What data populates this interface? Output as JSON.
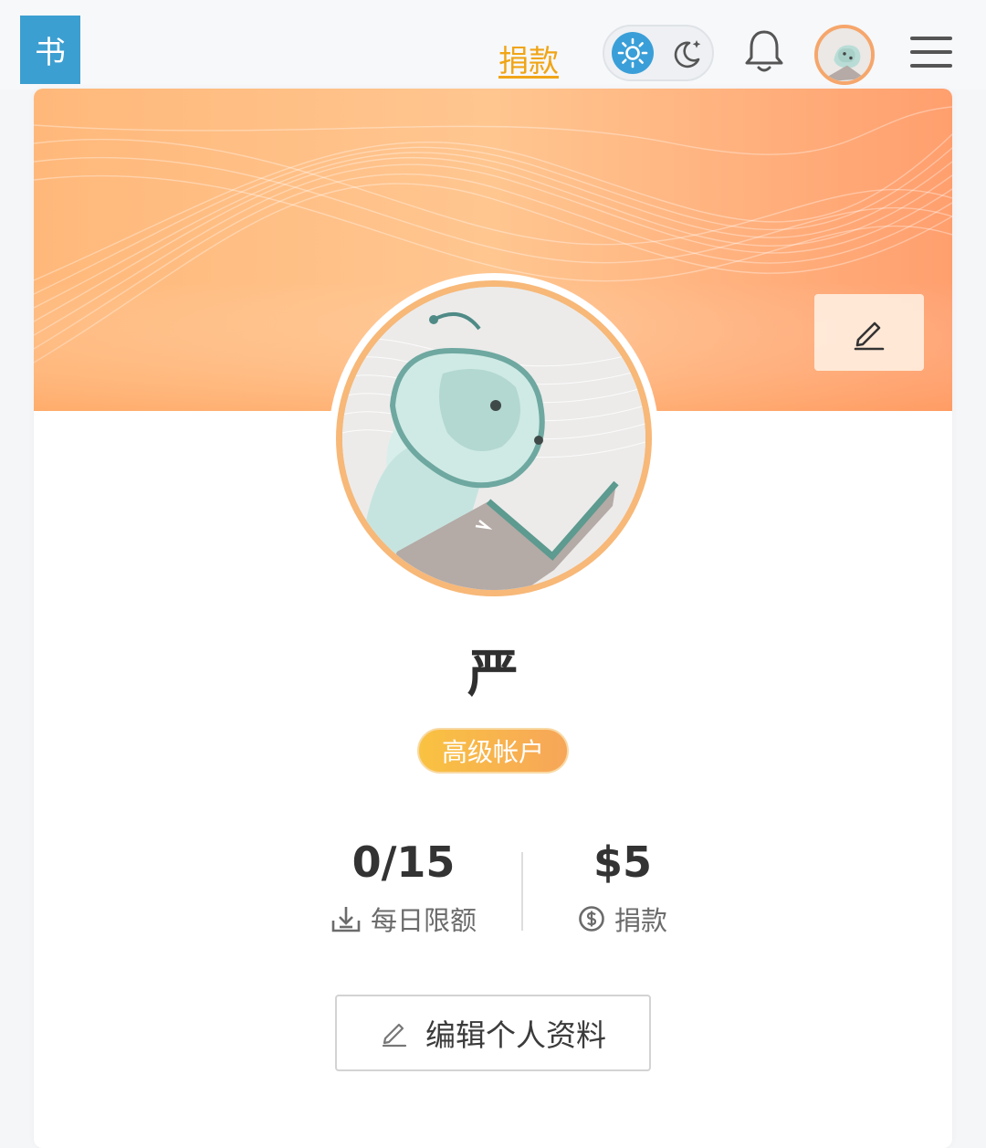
{
  "header": {
    "logo_text": "书",
    "donate_label": "捐款",
    "theme": {
      "active": "light"
    },
    "icons": [
      "sun-icon",
      "moon-icon",
      "bell-icon",
      "user-avatar",
      "menu-icon"
    ],
    "accent_color": "#f0a516",
    "brand_color": "#3c9fd1"
  },
  "profile": {
    "username": "严",
    "badge": "高级帐户",
    "stats": [
      {
        "value": "0/15",
        "label": "每日限额",
        "icon": "download-icon"
      },
      {
        "value": "$5",
        "label": "捐款",
        "icon": "dollar-circle-icon"
      }
    ],
    "edit_button": "编辑个人资料"
  }
}
